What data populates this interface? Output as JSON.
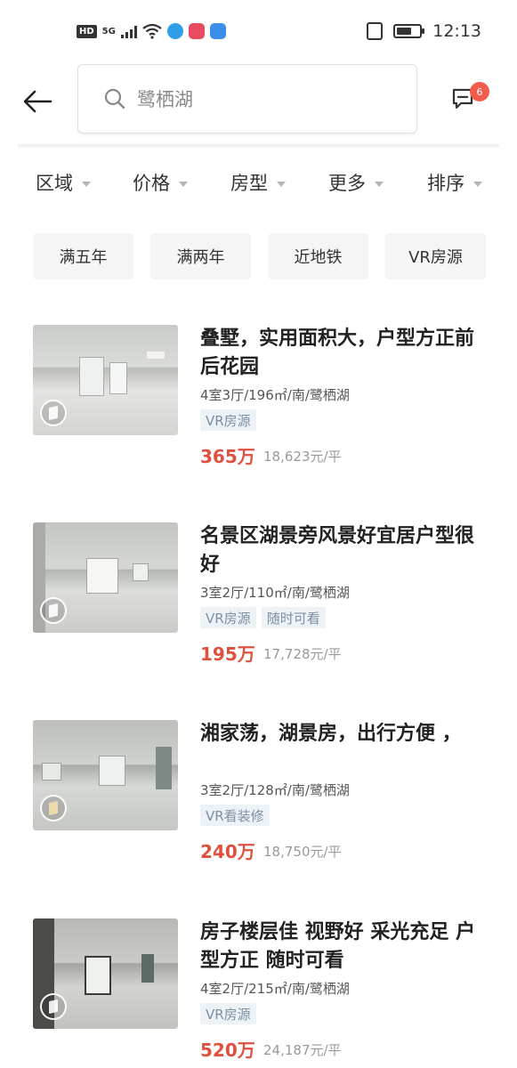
{
  "status_bar": {
    "hd": "HD",
    "network": "5G",
    "time": "12:13"
  },
  "header": {
    "search_placeholder": "鹭栖湖",
    "message_badge": "6"
  },
  "filters": [
    {
      "label": "区域"
    },
    {
      "label": "价格"
    },
    {
      "label": "房型"
    },
    {
      "label": "更多"
    },
    {
      "label": "排序"
    }
  ],
  "chips": [
    {
      "label": "满五年"
    },
    {
      "label": "满两年"
    },
    {
      "label": "近地铁"
    },
    {
      "label": "VR房源"
    }
  ],
  "listings": [
    {
      "title": "叠墅，实用面积大，户型方正前后花园",
      "meta": "4室3厅/196㎡/南/鹭栖湖",
      "tags": [
        "VR房源"
      ],
      "price": "365万",
      "unit_price": "18,623元/平"
    },
    {
      "title": "名景区湖景旁风景好宜居户型很好",
      "meta": "3室2厅/110㎡/南/鹭栖湖",
      "tags": [
        "VR房源",
        "随时可看"
      ],
      "price": "195万",
      "unit_price": "17,728元/平"
    },
    {
      "title": "湘家荡，湖景房，出行方便 ，",
      "meta": "3室2厅/128㎡/南/鹭栖湖",
      "tags": [
        "VR看装修"
      ],
      "price": "240万",
      "unit_price": "18,750元/平"
    },
    {
      "title": "房子楼层佳 视野好 采光充足 户型方正 随时可看",
      "meta": "4室2厅/215㎡/南/鹭栖湖",
      "tags": [
        "VR房源"
      ],
      "price": "520万",
      "unit_price": "24,187元/平"
    }
  ],
  "colors": {
    "price": "#e0503f",
    "badge": "#f25c4d",
    "tag_bg": "#edf2f7",
    "tag_text": "#7d8fa3"
  }
}
